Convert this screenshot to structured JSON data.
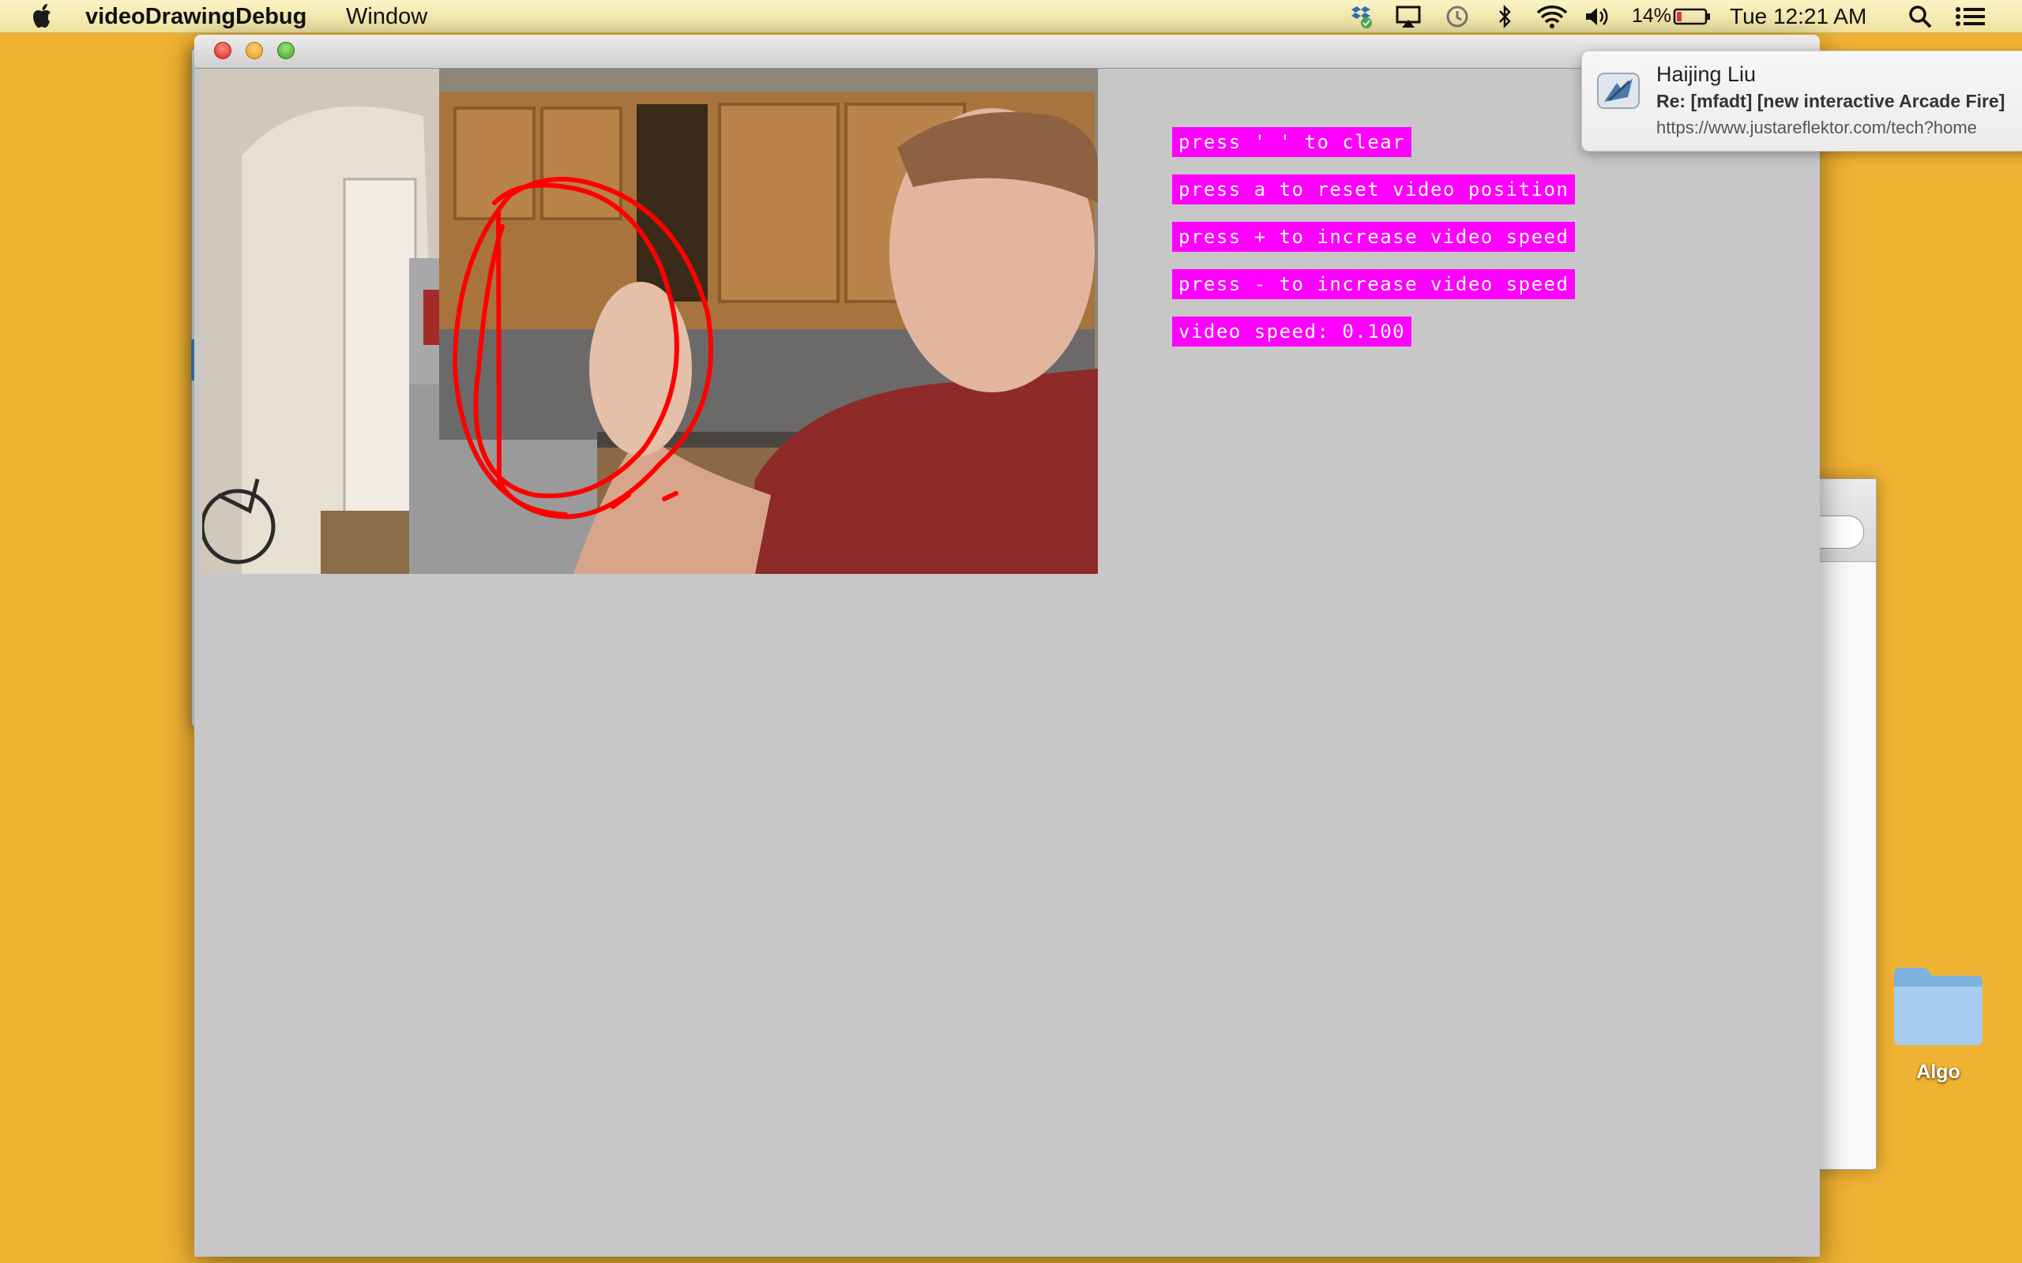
{
  "menubar": {
    "app_name": "videoDrawingDebug",
    "menu_window": "Window",
    "battery_percent": "14%",
    "clock": "Tue 12:21 AM",
    "icons": [
      "apple-icon",
      "dropbox-icon",
      "airplay-icon",
      "time-machine-icon",
      "bluetooth-icon",
      "wifi-icon",
      "volume-icon",
      "battery-icon",
      "spotlight-icon",
      "notification-center-icon"
    ]
  },
  "window": {
    "title_buttons": [
      "close",
      "minimize",
      "zoom"
    ],
    "labels": {
      "clear": "press ' ' to clear",
      "reset": "press a to reset video position",
      "increase": "press + to increase video speed",
      "decrease": "press - to increase video speed",
      "speed": "video speed: 0.100"
    },
    "drawing_color": "#ff0000",
    "label_color": "#ff00ff"
  },
  "notification": {
    "sender": "Haijing Liu",
    "subject": "Re: [mfadt] [new interactive Arcade Fire]",
    "preview": "https://www.justareflektor.com/tech?home",
    "icon": "mail-icon"
  },
  "desktop": {
    "folder_label": "Algo",
    "background_color": "#f0b232"
  }
}
